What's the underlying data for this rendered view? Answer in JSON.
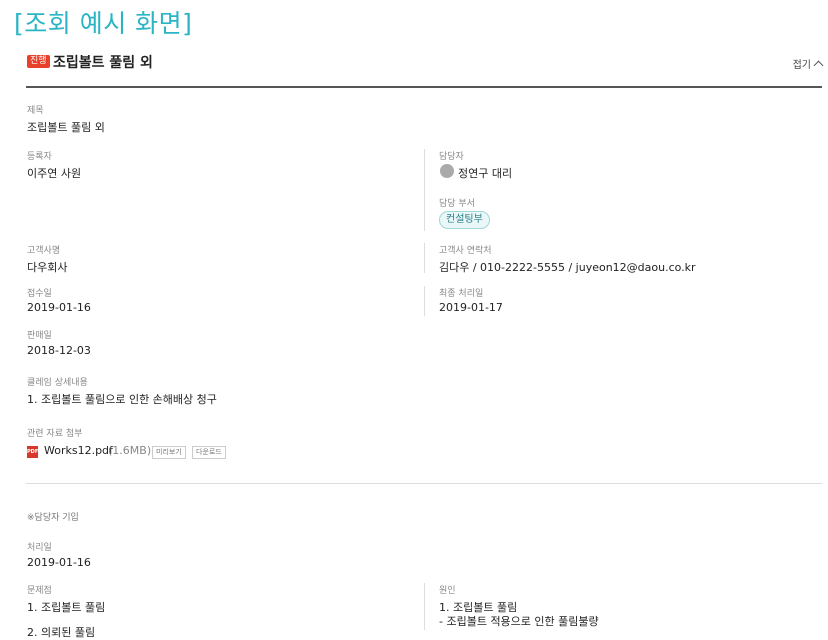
{
  "header": {
    "title": "[조회 예시 화면]"
  },
  "doc": {
    "status_badge": "진행",
    "title": "조립볼트 풀림 외",
    "fold_label": "접기"
  },
  "fields": {
    "subject": {
      "label": "제목",
      "value": "조립볼트 풀림 외"
    },
    "registrant": {
      "label": "등록자",
      "value": "이주연 사원"
    },
    "assignee": {
      "label": "담당자",
      "value": "정연구 대리"
    },
    "department": {
      "label": "담당 부서",
      "value": "컨설팅부"
    },
    "customer": {
      "label": "고객사명",
      "value": "다우회사"
    },
    "customer_contact": {
      "label": "고객사 연락처",
      "value": "김다우 / 010-2222-5555 / juyeon12@daou.co.kr"
    },
    "received_date": {
      "label": "접수일",
      "value": "2019-01-16"
    },
    "last_processed": {
      "label": "최종 처리일",
      "value": "2019-01-17"
    },
    "sale_date": {
      "label": "판매일",
      "value": "2018-12-03"
    },
    "claim_detail": {
      "label": "클레임 상세내용",
      "value": "1. 조립볼트 풀림으로 인한 손해배상 청구"
    },
    "attachment": {
      "label": "관련 자료 첨부",
      "icon": "pdf-icon",
      "file_name": "Works12.pdf",
      "file_size": "(1.6MB)",
      "preview_label": "미리보기",
      "download_label": "다운로드"
    }
  },
  "assignee_section": {
    "note": "※담당자 기입",
    "process_date": {
      "label": "처리일",
      "value": "2019-01-16"
    },
    "problem": {
      "label": "문제점",
      "value": "1. 조립볼트 풀림"
    },
    "cause": {
      "label": "원인",
      "line1": "1. 조립볼트 풀림",
      "line2": "- 조립볼트 적용으로 인한 풀림불량"
    },
    "partial_next": "2. 의뢰된 풀림"
  },
  "colors": {
    "accent": "#2bb5c4",
    "badge": "#e8412b"
  }
}
